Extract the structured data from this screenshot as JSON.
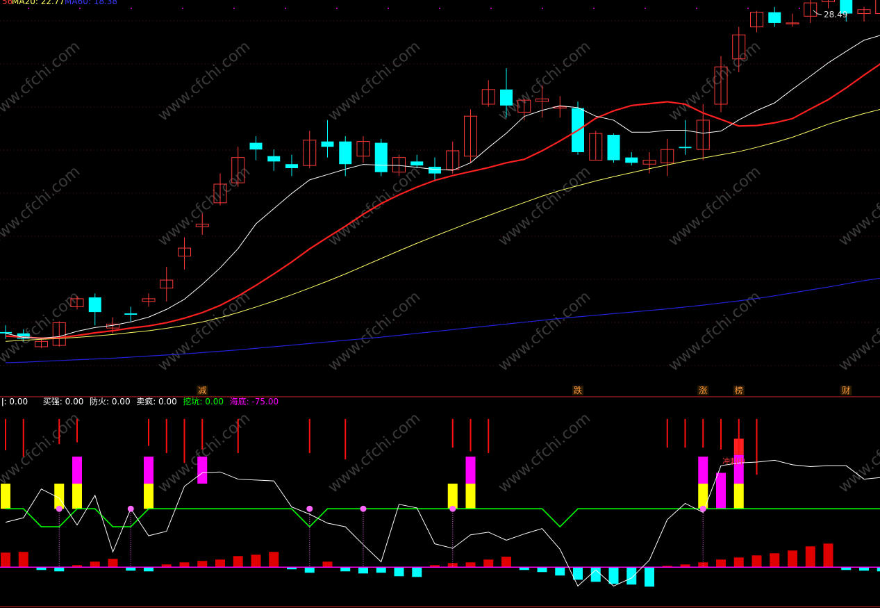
{
  "colors": {
    "up": "#ff3a3a",
    "down": "#00ffff",
    "ma5": "#ffffff",
    "ma10": "#ff2020",
    "ma20": "#ffff66",
    "ma60": "#2222dd",
    "green": "#00ff00",
    "magenta": "#ff00ff",
    "yellow": "#ffff00",
    "pink": "#ff66ff",
    "cyan": "#00ffff"
  },
  "header": {
    "ma20_label": "MA20: 22.77",
    "ma60_label": "MA60: 18.38",
    "peak_label": "28.49"
  },
  "watermark": "www.cfchi.com",
  "signals": [
    {
      "label": "减",
      "bar": 11
    },
    {
      "label": "跌",
      "bar": 32
    },
    {
      "label": "涨",
      "bar": 39
    },
    {
      "label": "榜",
      "bar": 41
    },
    {
      "label": "财",
      "bar": 47
    }
  ],
  "indicator_header": [
    {
      "key": "i0",
      "text": "ǀ: 0.00",
      "color": "#ffffff"
    },
    {
      "key": "i1",
      "text": "买强: 0.00",
      "color": "#ffffff"
    },
    {
      "key": "i2",
      "text": "防火: 0.00",
      "color": "#ffffff"
    },
    {
      "key": "i3",
      "text": "卖疯: 0.00",
      "color": "#ffffff"
    },
    {
      "key": "i4",
      "text": "挖坑: 0.00",
      "color": "#00ff00"
    },
    {
      "key": "i5",
      "text": "海底: -75.00",
      "color": "#ff00ff"
    }
  ],
  "indicator_text": "冲刺中",
  "chart_data": {
    "type": "candlestick",
    "y_range": [
      15.2,
      29.2
    ],
    "candles": [
      [
        16.95,
        16.9,
        17.2,
        16.7
      ],
      [
        16.9,
        16.7,
        17.05,
        16.6
      ],
      [
        16.4,
        16.6,
        16.7,
        16.35
      ],
      [
        16.45,
        17.3,
        17.35,
        16.4
      ],
      [
        17.9,
        18.2,
        18.3,
        17.8
      ],
      [
        18.25,
        17.7,
        18.4,
        17.2
      ],
      [
        17.1,
        17.25,
        17.5,
        16.9
      ],
      [
        17.65,
        17.6,
        17.9,
        17.35
      ],
      [
        18.1,
        18.2,
        18.4,
        17.9
      ],
      [
        18.6,
        18.9,
        19.4,
        18.1
      ],
      [
        19.8,
        20.1,
        20.5,
        19.3
      ],
      [
        20.9,
        21.0,
        21.4,
        20.6
      ],
      [
        21.8,
        22.5,
        22.9,
        21.7
      ],
      [
        22.55,
        23.5,
        23.9,
        22.4
      ],
      [
        24.05,
        23.8,
        24.3,
        23.4
      ],
      [
        23.55,
        23.35,
        23.8,
        23.0
      ],
      [
        23.25,
        23.1,
        23.6,
        22.8
      ],
      [
        23.2,
        24.15,
        24.5,
        23.1
      ],
      [
        24.1,
        23.9,
        24.9,
        23.5
      ],
      [
        24.1,
        23.25,
        24.3,
        22.8
      ],
      [
        23.55,
        24.1,
        24.3,
        23.3
      ],
      [
        24.05,
        22.95,
        24.2,
        22.8
      ],
      [
        22.95,
        23.5,
        23.6,
        22.8
      ],
      [
        23.35,
        23.2,
        23.6,
        23.1
      ],
      [
        23.15,
        22.9,
        23.5,
        22.6
      ],
      [
        23.05,
        23.75,
        24.1,
        22.9
      ],
      [
        23.55,
        25.05,
        25.3,
        23.3
      ],
      [
        25.5,
        26.05,
        26.4,
        25.4
      ],
      [
        26.05,
        25.45,
        26.85,
        25.0
      ],
      [
        25.2,
        25.65,
        25.7,
        24.9
      ],
      [
        25.6,
        25.7,
        26.2,
        25.0
      ],
      [
        25.35,
        25.4,
        25.8,
        25.0
      ],
      [
        25.35,
        23.7,
        25.6,
        23.6
      ],
      [
        23.4,
        24.4,
        24.5,
        23.4
      ],
      [
        24.35,
        23.4,
        24.4,
        23.3
      ],
      [
        23.5,
        23.3,
        23.7,
        23.2
      ],
      [
        23.25,
        23.4,
        23.7,
        22.9
      ],
      [
        23.3,
        23.8,
        24.2,
        22.8
      ],
      [
        23.9,
        23.85,
        24.9,
        23.6
      ],
      [
        23.8,
        24.9,
        25.5,
        23.4
      ],
      [
        25.5,
        26.9,
        27.3,
        25.2
      ],
      [
        27.2,
        28.1,
        28.4,
        26.7
      ],
      [
        28.4,
        28.95,
        29.0,
        28.2
      ],
      [
        28.95,
        28.55,
        29.15,
        28.4
      ],
      [
        28.55,
        28.55,
        28.9,
        28.4
      ],
      [
        28.8,
        29.3,
        29.7,
        28.55
      ],
      [
        29.35,
        29.95,
        30.55,
        29.1
      ],
      [
        29.95,
        28.9,
        30.05,
        28.6
      ],
      [
        28.9,
        29.05,
        29.15,
        28.6
      ],
      [
        28.9,
        29.45,
        30.1,
        28.8
      ]
    ],
    "ma5": [
      16.9,
      16.75,
      16.72,
      16.78,
      16.98,
      17.12,
      17.2,
      17.33,
      17.51,
      17.8,
      18.18,
      18.74,
      19.36,
      20.08,
      21.01,
      21.58,
      22.15,
      22.66,
      22.86,
      23.06,
      23.24,
      23.21,
      23.2,
      23.13,
      23.05,
      23.02,
      23.3,
      23.87,
      24.41,
      25.04,
      25.27,
      25.44,
      25.37,
      25.05,
      24.9,
      24.45,
      24.45,
      24.52,
      24.52,
      24.41,
      24.49,
      24.91,
      25.26,
      25.55,
      26.06,
      26.55,
      27.05,
      27.48,
      27.9,
      28.1
    ],
    "ma10": [
      16.8,
      16.76,
      16.72,
      16.74,
      16.82,
      16.92,
      17.0,
      17.1,
      17.18,
      17.3,
      17.47,
      17.68,
      17.95,
      18.3,
      18.7,
      19.13,
      19.58,
      20.07,
      20.5,
      20.92,
      21.37,
      21.77,
      22.1,
      22.39,
      22.64,
      22.82,
      22.97,
      23.12,
      23.3,
      23.43,
      23.75,
      24.12,
      24.52,
      24.97,
      25.25,
      25.45,
      25.52,
      25.59,
      25.5,
      25.17,
      24.93,
      24.68,
      24.7,
      24.8,
      24.96,
      25.32,
      25.67,
      26.11,
      26.59,
      27.05
    ],
    "ma20": [
      16.6,
      16.64,
      16.68,
      16.71,
      16.75,
      16.8,
      16.86,
      16.93,
      17.0,
      17.09,
      17.2,
      17.33,
      17.49,
      17.68,
      17.89,
      18.11,
      18.35,
      18.6,
      18.86,
      19.13,
      19.42,
      19.71,
      20.0,
      20.28,
      20.55,
      20.81,
      21.07,
      21.32,
      21.57,
      21.81,
      22.05,
      22.26,
      22.44,
      22.62,
      22.78,
      22.93,
      23.08,
      23.22,
      23.36,
      23.48,
      23.6,
      23.72,
      23.88,
      24.06,
      24.26,
      24.5,
      24.75,
      24.96,
      25.15,
      25.32
    ],
    "ma60": [
      15.8,
      15.82,
      15.85,
      15.88,
      15.91,
      15.94,
      15.97,
      16.01,
      16.05,
      16.09,
      16.13,
      16.18,
      16.23,
      16.28,
      16.34,
      16.4,
      16.46,
      16.52,
      16.58,
      16.64,
      16.7,
      16.76,
      16.83,
      16.9,
      16.97,
      17.04,
      17.11,
      17.18,
      17.25,
      17.32,
      17.39,
      17.46,
      17.52,
      17.58,
      17.64,
      17.7,
      17.76,
      17.82,
      17.89,
      17.96,
      18.04,
      18.12,
      18.21,
      18.31,
      18.42,
      18.53,
      18.64,
      18.76,
      18.88,
      18.98
    ],
    "indicator": {
      "y_range": [
        -115,
        100
      ],
      "white_line": [
        -25,
        -20,
        12,
        2,
        -28,
        5,
        -58,
        -10,
        -40,
        -35,
        15,
        30,
        31,
        23,
        22,
        21,
        -8,
        -16,
        -26,
        -30,
        -50,
        -69,
        -5,
        -9,
        -49,
        -54,
        -39,
        -36,
        -45,
        -38,
        -32,
        -55,
        -96,
        -78,
        -96,
        -87,
        -67,
        -22,
        -4,
        -14,
        38,
        41,
        42,
        44,
        39,
        37,
        38,
        38,
        23,
        25
      ],
      "green_line": [
        -10,
        -10,
        -30,
        -30,
        -10,
        -10,
        -30,
        -30,
        -10,
        -10,
        -10,
        -10,
        -10,
        -10,
        -10,
        -10,
        -10,
        -30,
        -10,
        -10,
        -10,
        -10,
        -10,
        -10,
        -10,
        -10,
        -10,
        -10,
        -10,
        -10,
        -10,
        -30,
        -10,
        -10,
        -10,
        -10,
        -10,
        -10,
        -10,
        -10,
        -10,
        -10,
        -10,
        -10,
        -10,
        -10,
        -10,
        -10,
        -10,
        -10
      ],
      "red_spikes": [
        [
          0,
          55
        ],
        [
          1,
          48
        ],
        [
          3,
          62
        ],
        [
          4,
          64
        ],
        [
          8,
          60
        ],
        [
          9,
          52
        ],
        [
          10,
          41
        ],
        [
          11,
          56
        ],
        [
          13,
          52
        ],
        [
          17,
          52
        ],
        [
          19,
          45
        ],
        [
          25,
          58
        ],
        [
          26,
          54
        ],
        [
          27,
          52
        ],
        [
          37,
          58
        ],
        [
          38,
          58
        ],
        [
          39,
          58
        ],
        [
          40,
          56
        ],
        [
          41,
          50
        ],
        [
          42,
          28
        ]
      ],
      "bars": [
        [
          0,
          "yellow",
          -10,
          18
        ],
        [
          3,
          "yellow",
          -10,
          18
        ],
        [
          4,
          "yellow",
          -10,
          18
        ],
        [
          4,
          "magenta",
          18,
          48
        ],
        [
          8,
          "yellow",
          -10,
          18
        ],
        [
          8,
          "magenta",
          18,
          48
        ],
        [
          11,
          "magenta",
          18,
          48
        ],
        [
          25,
          "yellow",
          -10,
          18
        ],
        [
          26,
          "yellow",
          -10,
          18
        ],
        [
          26,
          "magenta",
          18,
          48
        ],
        [
          39,
          "yellow",
          -10,
          18
        ],
        [
          39,
          "magenta",
          18,
          48
        ],
        [
          40,
          "magenta",
          -10,
          30
        ],
        [
          41,
          "yellow",
          -10,
          18
        ],
        [
          41,
          "magenta",
          18,
          50
        ],
        [
          41,
          "red",
          50,
          68
        ]
      ],
      "markers": [
        3,
        7,
        17,
        20,
        25,
        39
      ],
      "hist": [
        21,
        22,
        -4,
        -6,
        3,
        8,
        12,
        -5,
        -6,
        4,
        7,
        9,
        11,
        16,
        18,
        22,
        -3,
        -8,
        8,
        -6,
        -9,
        -8,
        -13,
        -14,
        3,
        6,
        7,
        11,
        15,
        -4,
        -7,
        -12,
        -18,
        -21,
        -24,
        -25,
        -28,
        2,
        4,
        7,
        11,
        14,
        17,
        20,
        24,
        30,
        34,
        -4,
        -5,
        -6
      ]
    }
  }
}
